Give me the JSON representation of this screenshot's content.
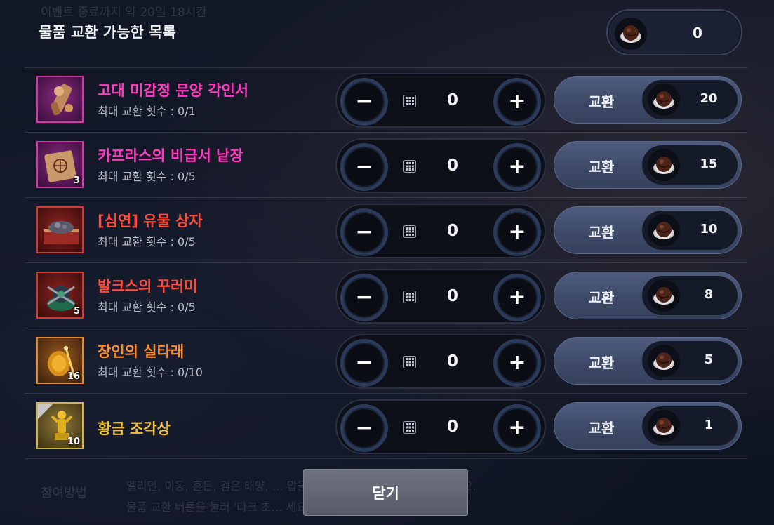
{
  "header": {
    "bg_lines": [
      "이벤트 종료까지 약 20일 18시간",
      "이벤트 종료까지 약 20일 18시간"
    ],
    "title": "물품 교환 가능한 목록",
    "currency_icon": "chocolate-icon",
    "currency_amount": "0"
  },
  "rows": [
    {
      "name": "고대 미감정 문양 각인서",
      "limit": "최대 교환 횟수 : 0/1",
      "count": "",
      "tier": "pink",
      "name_color": "#ff3bc0",
      "icon": "scroll-jar-icon",
      "qty": "0",
      "exchange_label": "교환",
      "cost": "20"
    },
    {
      "name": "카프라스의 비급서 낱장",
      "limit": "최대 교환 횟수 : 0/5",
      "count": "3",
      "tier": "pink",
      "name_color": "#ff3bc0",
      "icon": "parchment-icon",
      "qty": "0",
      "exchange_label": "교환",
      "cost": "15"
    },
    {
      "name": "[심연] 유물 상자",
      "limit": "최대 교환 횟수 : 0/5",
      "count": "",
      "tier": "red",
      "name_color": "#ff4a3a",
      "icon": "relic-box-icon",
      "qty": "0",
      "exchange_label": "교환",
      "cost": "10"
    },
    {
      "name": "발크스의 꾸러미",
      "limit": "최대 교환 횟수 : 0/5",
      "count": "5",
      "tier": "red",
      "name_color": "#ff4a3a",
      "icon": "bundle-icon",
      "qty": "0",
      "exchange_label": "교환",
      "cost": "8"
    },
    {
      "name": "장인의 실타래",
      "limit": "최대 교환 횟수 : 0/10",
      "count": "16",
      "tier": "orange",
      "name_color": "#ff8a2a",
      "icon": "thread-spool-icon",
      "qty": "0",
      "exchange_label": "교환",
      "cost": "5"
    },
    {
      "name": "황금 조각상",
      "limit": "",
      "count": "10",
      "tier": "gold",
      "name_color": "#f0c040",
      "icon": "golden-statue-icon",
      "qty": "0",
      "exchange_label": "교환",
      "cost": "1"
    }
  ],
  "controls": {
    "minus_symbol": "−",
    "plus_symbol": "+",
    "keypad_icon": "keypad-icon",
    "cost_icon": "chocolate-icon"
  },
  "footer": {
    "close_label": "닫기",
    "ghost_left": "참여방법",
    "ghost_lines": [
      "엘리언, 이동, 흔든, 검은 태양, …                                     압을 통해 '다크 초콜릿'을 획득해보세요.",
      "물품 교환 버튼을 눌러 '다크 초…                                                                  세요."
    ]
  }
}
